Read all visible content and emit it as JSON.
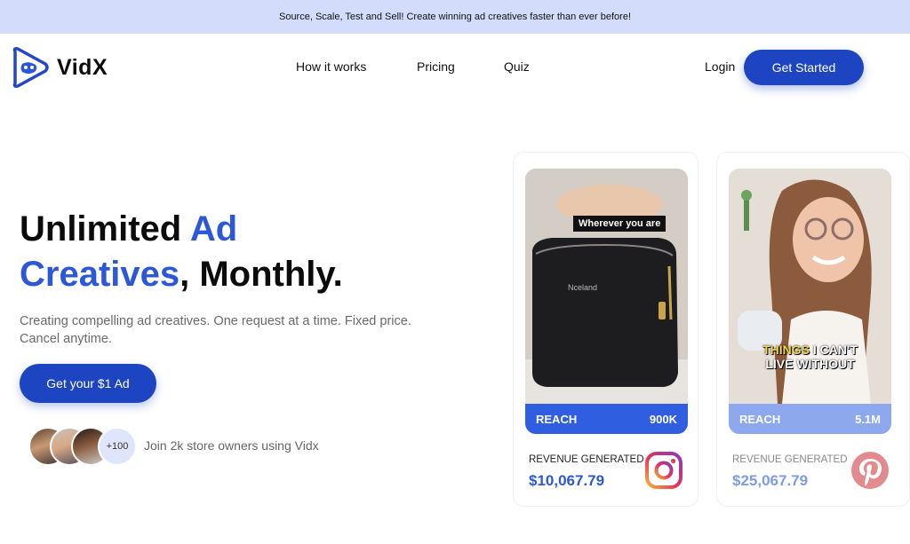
{
  "banner": {
    "text": "Source, Scale, Test and Sell! Create winning ad creatives faster than ever before!"
  },
  "nav": {
    "logo_text": "VidX",
    "links": [
      "How it works",
      "Pricing",
      "Quiz"
    ],
    "login": "Login",
    "cta": "Get Started"
  },
  "hero": {
    "title_1": "Unlimited ",
    "title_accent_1": "Ad",
    "title_accent_2": "Creatives",
    "title_2": ", Monthly.",
    "subtitle": "Creating compelling ad creatives. One request at a time. Fixed price. Cancel anytime.",
    "cta": "Get your $1 Ad",
    "avatar_count": "+100",
    "join_text": "Join 2k store owners using Vidx"
  },
  "cards": [
    {
      "caption": "Wherever you are",
      "product_label": "Nceland",
      "reach_label": "REACH",
      "reach_value": "900K",
      "revenue_label": "REVENUE GENERATED",
      "revenue_value": "$10,067.79",
      "platform_icon": "instagram-icon"
    },
    {
      "caption_highlight": "THINGS",
      "caption_rest": " I CAN'T",
      "caption_line2": "LIVE WITHOUT",
      "reach_label": "REACH",
      "reach_value": "5.1M",
      "revenue_label": "REVENUE GENERATED",
      "revenue_value": "$25,067.79",
      "platform_icon": "pinterest-icon"
    }
  ],
  "colors": {
    "banner_bg": "#d4dcfb",
    "primary": "#1d45c2",
    "accent_text": "#2c58d8",
    "reach_bar_1": "#2f5ee0",
    "reach_bar_2": "#8ea8ef",
    "pinterest": "#e38a8e"
  }
}
